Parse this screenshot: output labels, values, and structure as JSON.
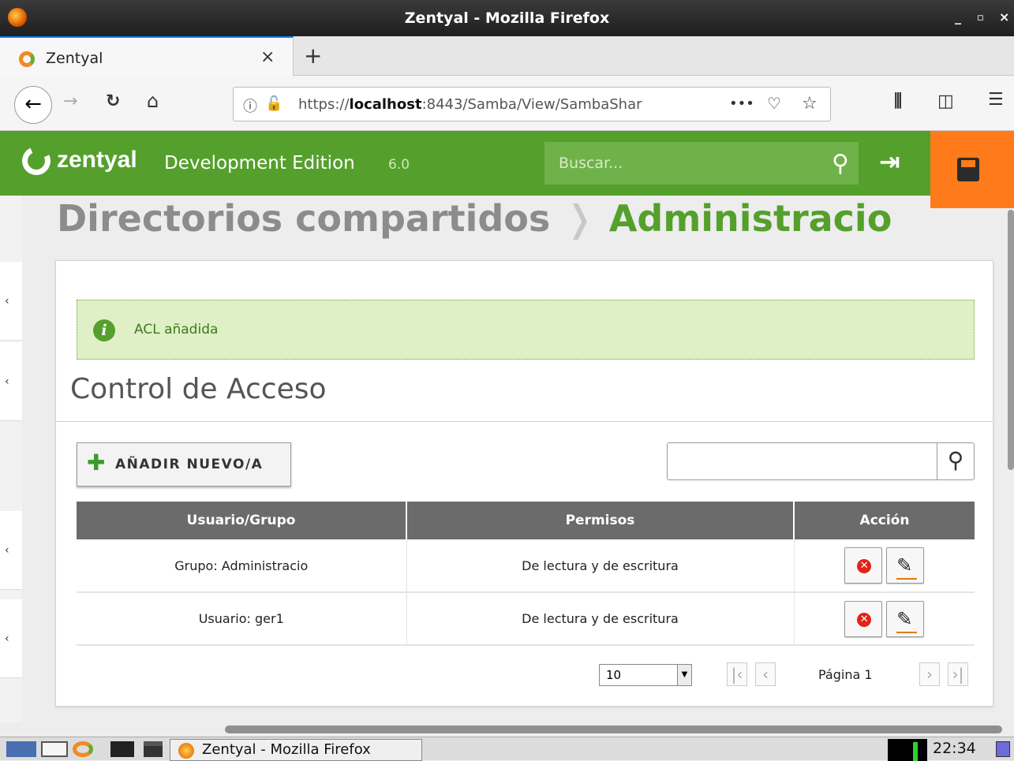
{
  "window": {
    "title": "Zentyal - Mozilla Firefox",
    "controls": [
      "_",
      "▫",
      "×"
    ]
  },
  "tabs": [
    {
      "label": "Zentyal",
      "icon": "zentyal-favicon"
    }
  ],
  "nav": {
    "url_prefix": "https://",
    "url_host": "localhost",
    "url_rest": ":8443/Samba/View/SambaShar",
    "more": "•••"
  },
  "header": {
    "brand": "zentyal",
    "edition": "Development Edition",
    "version": "6.0",
    "search_placeholder": "Buscar...",
    "brand_color": "#55a02c",
    "save_color": "#ff7a1a"
  },
  "breadcrumb": {
    "parent": "Directorios compartidos",
    "separator": "❭",
    "current": "Administracio"
  },
  "notice": {
    "message": "ACL añadida"
  },
  "section": {
    "title": "Control de Acceso",
    "add_button": "AÑADIR NUEVO/A"
  },
  "table": {
    "headers": [
      "Usuario/Grupo",
      "Permisos",
      "Acción"
    ],
    "rows": [
      {
        "who": "Grupo: Administracio",
        "perm": "De lectura y de escritura"
      },
      {
        "who": "Usuario: ger1",
        "perm": "De lectura y de escritura"
      }
    ]
  },
  "pager": {
    "page_size": "10",
    "page_label": "Página 1"
  },
  "taskbar": {
    "task": "Zentyal - Mozilla Firefox",
    "clock": "22:34"
  }
}
